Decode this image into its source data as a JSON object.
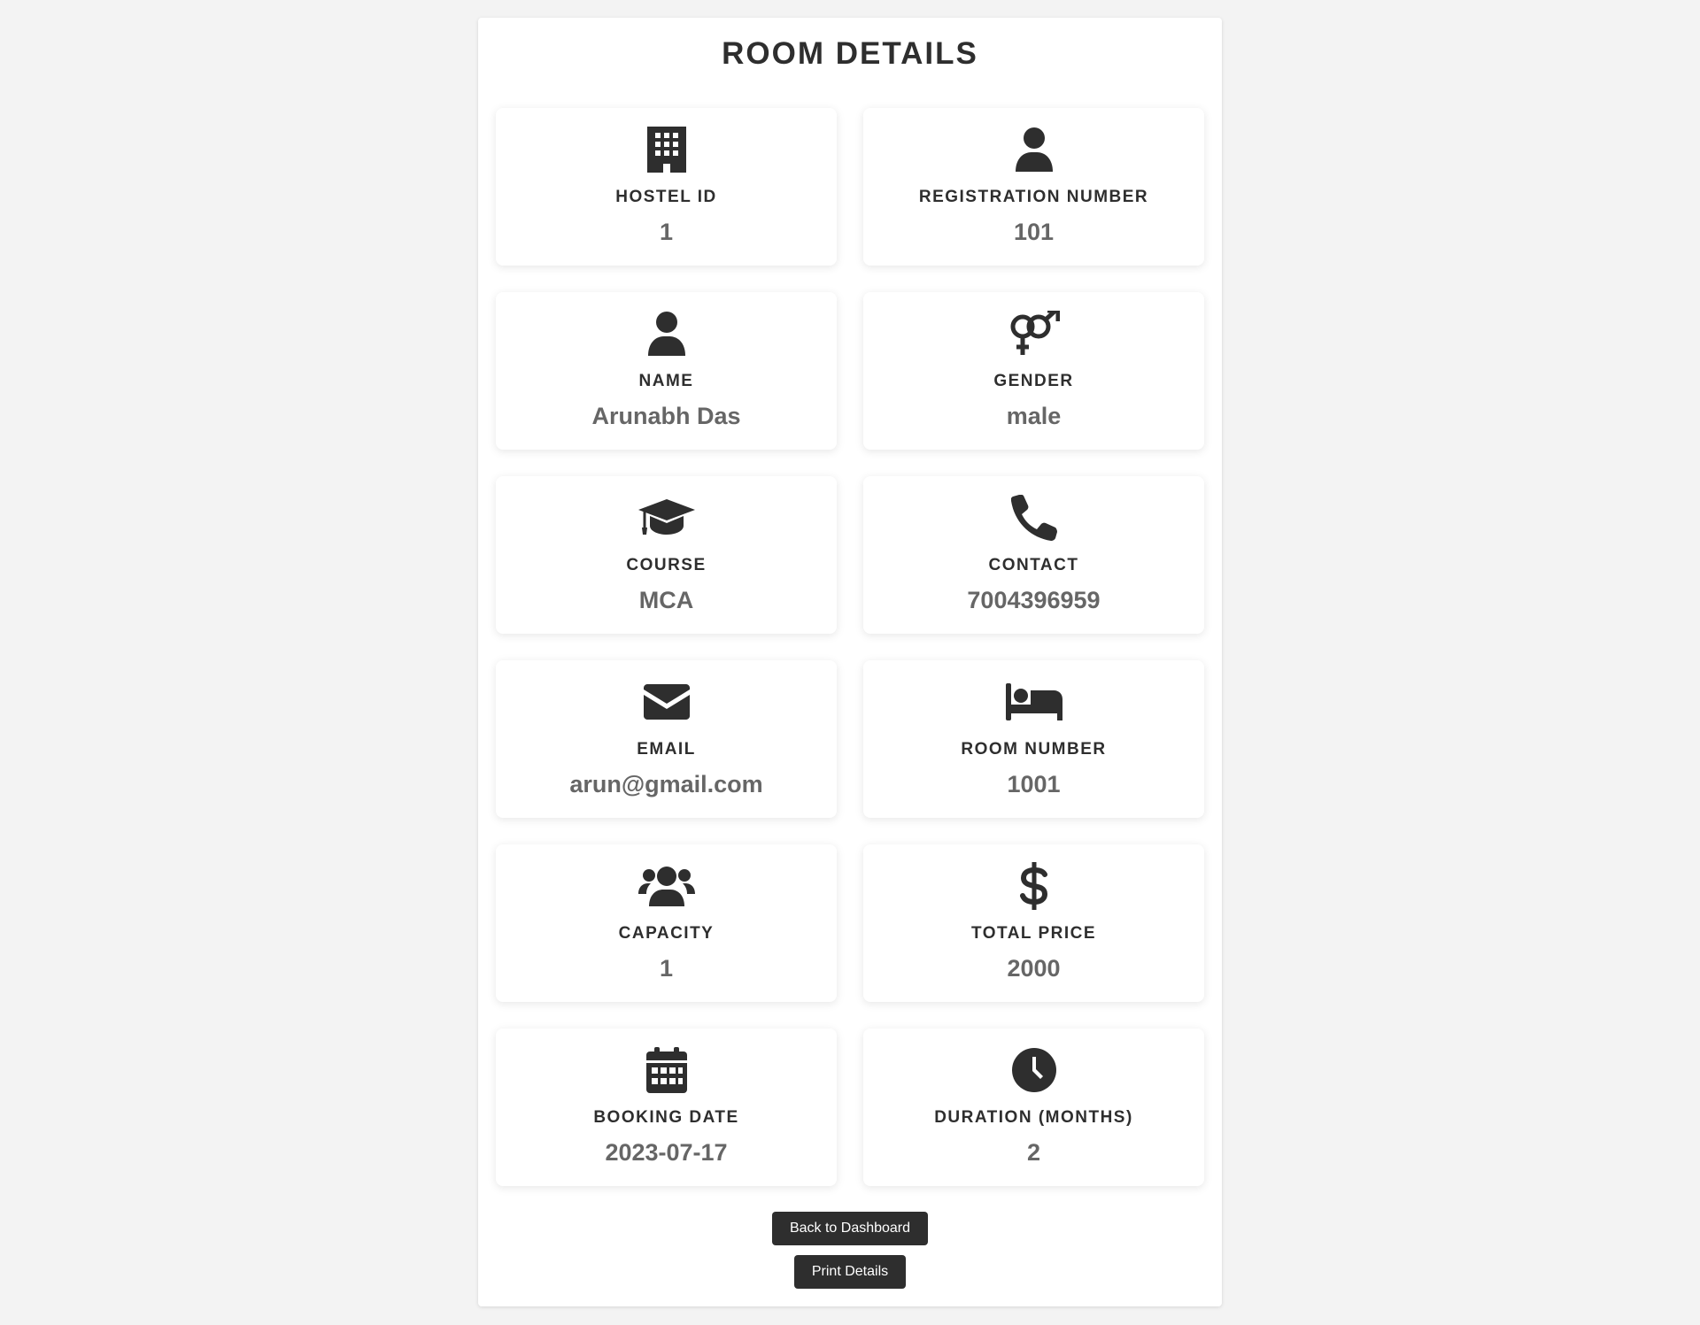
{
  "page": {
    "title": "ROOM DETAILS"
  },
  "colors": {
    "background": "#f3f3f3",
    "card": "#ffffff",
    "text_dark": "#2e2e2e",
    "text_value": "#666666",
    "button": "#2e2e2e"
  },
  "cards": [
    {
      "icon": "building-icon",
      "label": "HOSTEL ID",
      "value": "1"
    },
    {
      "icon": "user-icon",
      "label": "REGISTRATION NUMBER",
      "value": "101"
    },
    {
      "icon": "user-icon",
      "label": "NAME",
      "value": "Arunabh Das"
    },
    {
      "icon": "venus-mars-icon",
      "label": "GENDER",
      "value": "male"
    },
    {
      "icon": "graduation-cap-icon",
      "label": "COURSE",
      "value": "MCA"
    },
    {
      "icon": "phone-icon",
      "label": "CONTACT",
      "value": "7004396959"
    },
    {
      "icon": "envelope-icon",
      "label": "EMAIL",
      "value": "arun@gmail.com"
    },
    {
      "icon": "bed-icon",
      "label": "ROOM NUMBER",
      "value": "1001"
    },
    {
      "icon": "users-icon",
      "label": "CAPACITY",
      "value": "1"
    },
    {
      "icon": "dollar-icon",
      "label": "TOTAL PRICE",
      "value": "2000"
    },
    {
      "icon": "calendar-icon",
      "label": "BOOKING DATE",
      "value": "2023-07-17"
    },
    {
      "icon": "clock-icon",
      "label": "DURATION (MONTHS)",
      "value": "2"
    }
  ],
  "actions": {
    "back_label": "Back to Dashboard",
    "print_label": "Print Details"
  }
}
